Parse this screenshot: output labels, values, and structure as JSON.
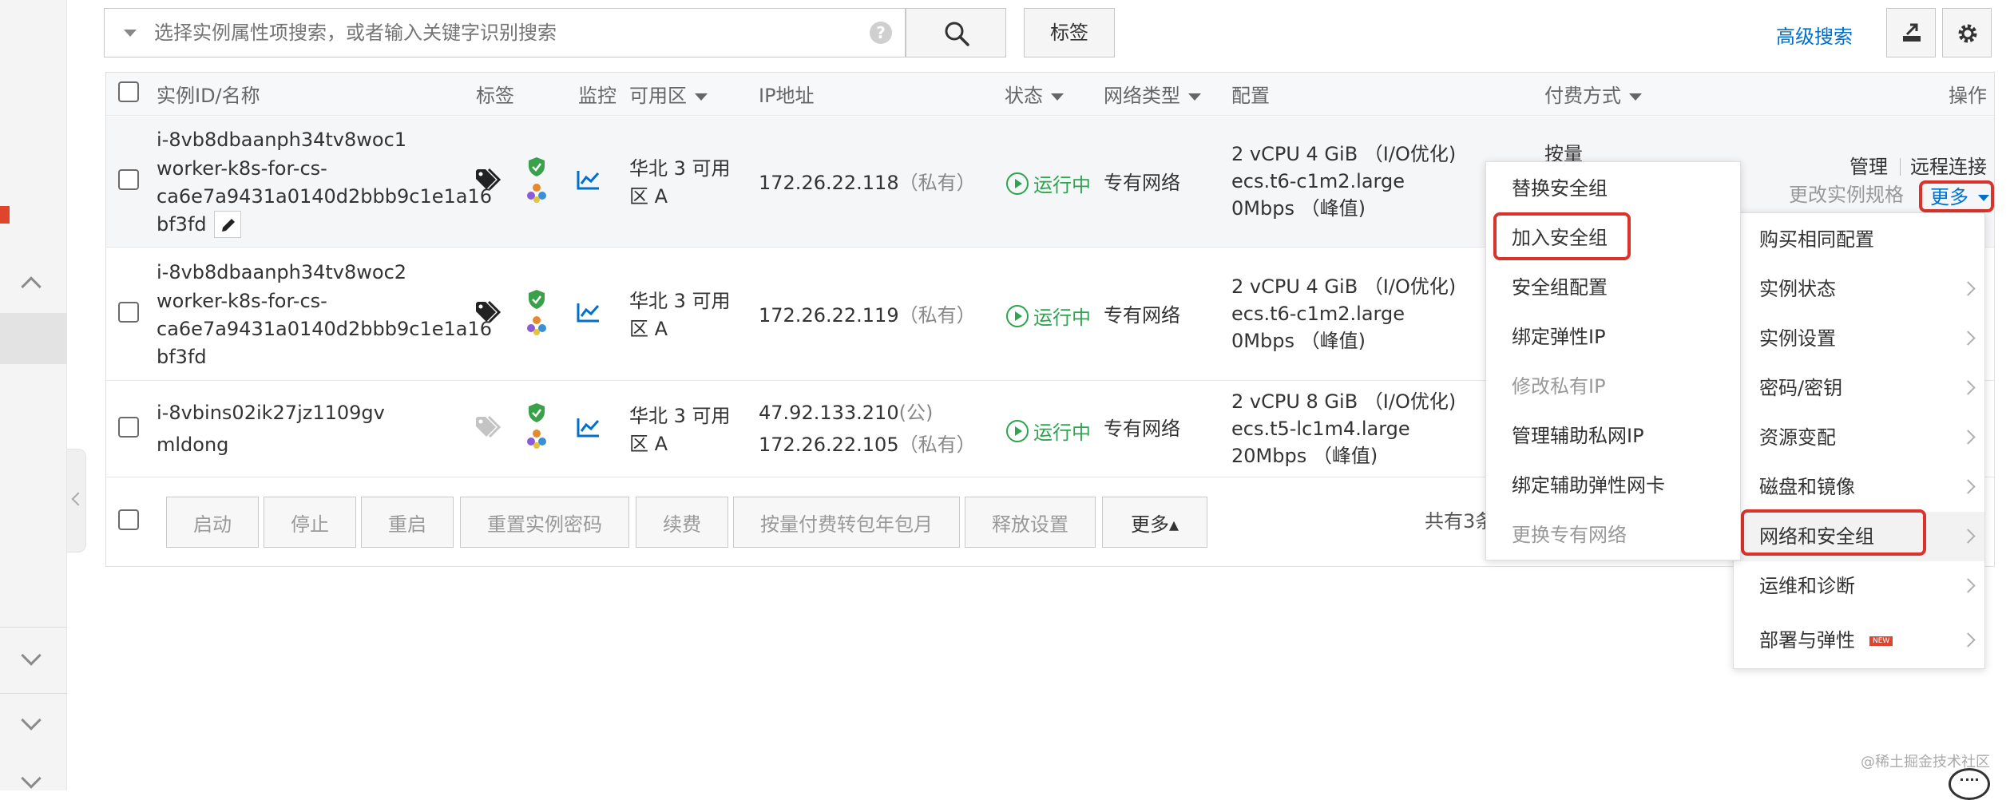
{
  "search": {
    "placeholder": "选择实例属性项搜索，或者输入关键字识别搜索",
    "tag_button": "标签",
    "advanced_search": "高级搜索"
  },
  "table": {
    "headers": {
      "id_name": "实例ID/名称",
      "tag": "标签",
      "monitor": "监控",
      "zone": "可用区",
      "ip": "IP地址",
      "status": "状态",
      "network_type": "网络类型",
      "config": "配置",
      "billing": "付费方式",
      "action": "操作"
    },
    "rows": [
      {
        "id": "i-8vb8dbaanph34tv8woc1",
        "name_lines": [
          "worker-k8s-for-cs-",
          "ca6e7a9431a0140d2bbb9c1e1a16",
          "bf3fd"
        ],
        "zone_lines": [
          "华北 3 可用",
          "区 A"
        ],
        "ip_lines": [
          {
            "ip": "172.26.22.118",
            "kind": "（私有）"
          }
        ],
        "status": "运行中",
        "network": "专有网络",
        "config": {
          "spec": "2 vCPU 4 GiB （I/O优化)",
          "type": "ecs.t6-c1m2.large",
          "bandwidth": "0Mbps （峰值)"
        },
        "billing": "按量"
      },
      {
        "id": "i-8vb8dbaanph34tv8woc2",
        "name_lines": [
          "worker-k8s-for-cs-",
          "ca6e7a9431a0140d2bbb9c1e1a16",
          "bf3fd"
        ],
        "zone_lines": [
          "华北 3 可用",
          "区 A"
        ],
        "ip_lines": [
          {
            "ip": "172.26.22.119",
            "kind": "（私有）"
          }
        ],
        "status": "运行中",
        "network": "专有网络",
        "config": {
          "spec": "2 vCPU 4 GiB （I/O优化)",
          "type": "ecs.t6-c1m2.large",
          "bandwidth": "0Mbps （峰值)"
        }
      },
      {
        "id": "i-8vbins02ik27jz1109gv",
        "name_lines": [
          "mldong"
        ],
        "zone_lines": [
          "华北 3 可用",
          "区 A"
        ],
        "ip_lines": [
          {
            "ip": "47.92.133.210",
            "kind": "(公)"
          },
          {
            "ip": "172.26.22.105",
            "kind": "（私有）"
          }
        ],
        "status": "运行中",
        "network": "专有网络",
        "config": {
          "spec": "2 vCPU 8 GiB （I/O优化)",
          "type": "ecs.t5-lc1m4.large",
          "bandwidth": "20Mbps （峰值)"
        }
      }
    ],
    "row_actions": {
      "manage": "管理",
      "remote": "远程连接",
      "change_spec": "更改实例规格",
      "more": "更多"
    }
  },
  "footer": {
    "buttons": [
      "启动",
      "停止",
      "重启",
      "重置实例密码",
      "续费",
      "按量付费转包年包月",
      "释放设置"
    ],
    "more": "更多▴",
    "total": "共有3条"
  },
  "more_menu": {
    "items": [
      "购买相同配置",
      "实例状态",
      "实例设置",
      "密码/密钥",
      "资源变配",
      "磁盘和镜像",
      "网络和安全组",
      "运维和诊断",
      "部署与弹性"
    ],
    "highlighted": "网络和安全组",
    "new_badge": "NEW"
  },
  "network_submenu": {
    "items": [
      {
        "label": "替换安全组",
        "disabled": false
      },
      {
        "label": "加入安全组",
        "disabled": false,
        "highlighted": true
      },
      {
        "label": "安全组配置",
        "disabled": false
      },
      {
        "label": "绑定弹性IP",
        "disabled": false
      },
      {
        "label": "修改私有IP",
        "disabled": true
      },
      {
        "label": "管理辅助私网IP",
        "disabled": false
      },
      {
        "label": "绑定辅助弹性网卡",
        "disabled": false
      },
      {
        "label": "更换专有网络",
        "disabled": true
      }
    ]
  },
  "watermark": "@稀土掘金技术社区",
  "colors": {
    "link": "#0070cc",
    "running": "#2da44e",
    "highlight_border": "#d9342b",
    "shield": "#3aa04a"
  }
}
